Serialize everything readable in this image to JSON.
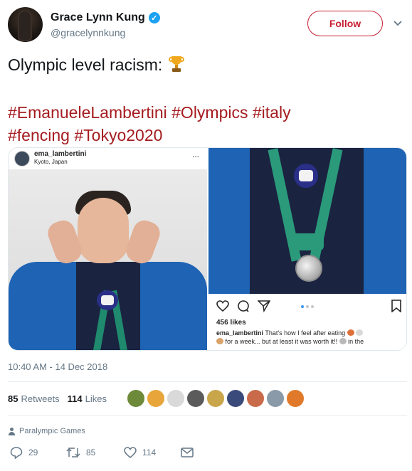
{
  "author": {
    "display_name": "Grace Lynn Kung",
    "handle": "@gracelynnkung",
    "verified_mark": "✓"
  },
  "follow_label": "Follow",
  "tweet": {
    "text": "Olympic level racism:",
    "hashtags": [
      "#EmanueleLambertini",
      "#Olympics",
      "#italy",
      "#fencing",
      "#Tokyo2020"
    ]
  },
  "media": {
    "instagram": {
      "username": "ema_lambertini",
      "location": "Kyoto, Japan",
      "more": "...",
      "likes": "456 likes",
      "caption_user": "ema_lambertini",
      "caption_part1": "That's how I feel after eating",
      "caption_part2": "for a week... but at least it was worth it!!",
      "caption_part3": "in the"
    }
  },
  "timestamp": "10:40 AM - 14 Dec 2018",
  "stats": {
    "retweets_count": "85",
    "retweets_label": "Retweets",
    "likes_count": "114",
    "likes_label": "Likes"
  },
  "liker_avatar_colors": [
    "#6d8a3a",
    "#e8a53a",
    "#d9d9d9",
    "#5b5b5b",
    "#c9a64a",
    "#3a4a7a",
    "#c96a4a",
    "#8a9aa8",
    "#e07a2a"
  ],
  "context_label": "Paralympic Games",
  "actions": {
    "reply_count": "29",
    "retweet_count": "85",
    "like_count": "114"
  },
  "colors": {
    "accent": "#c81d31",
    "hashtag": "#a51b1f",
    "muted": "#657786",
    "verified": "#1da1f2"
  }
}
